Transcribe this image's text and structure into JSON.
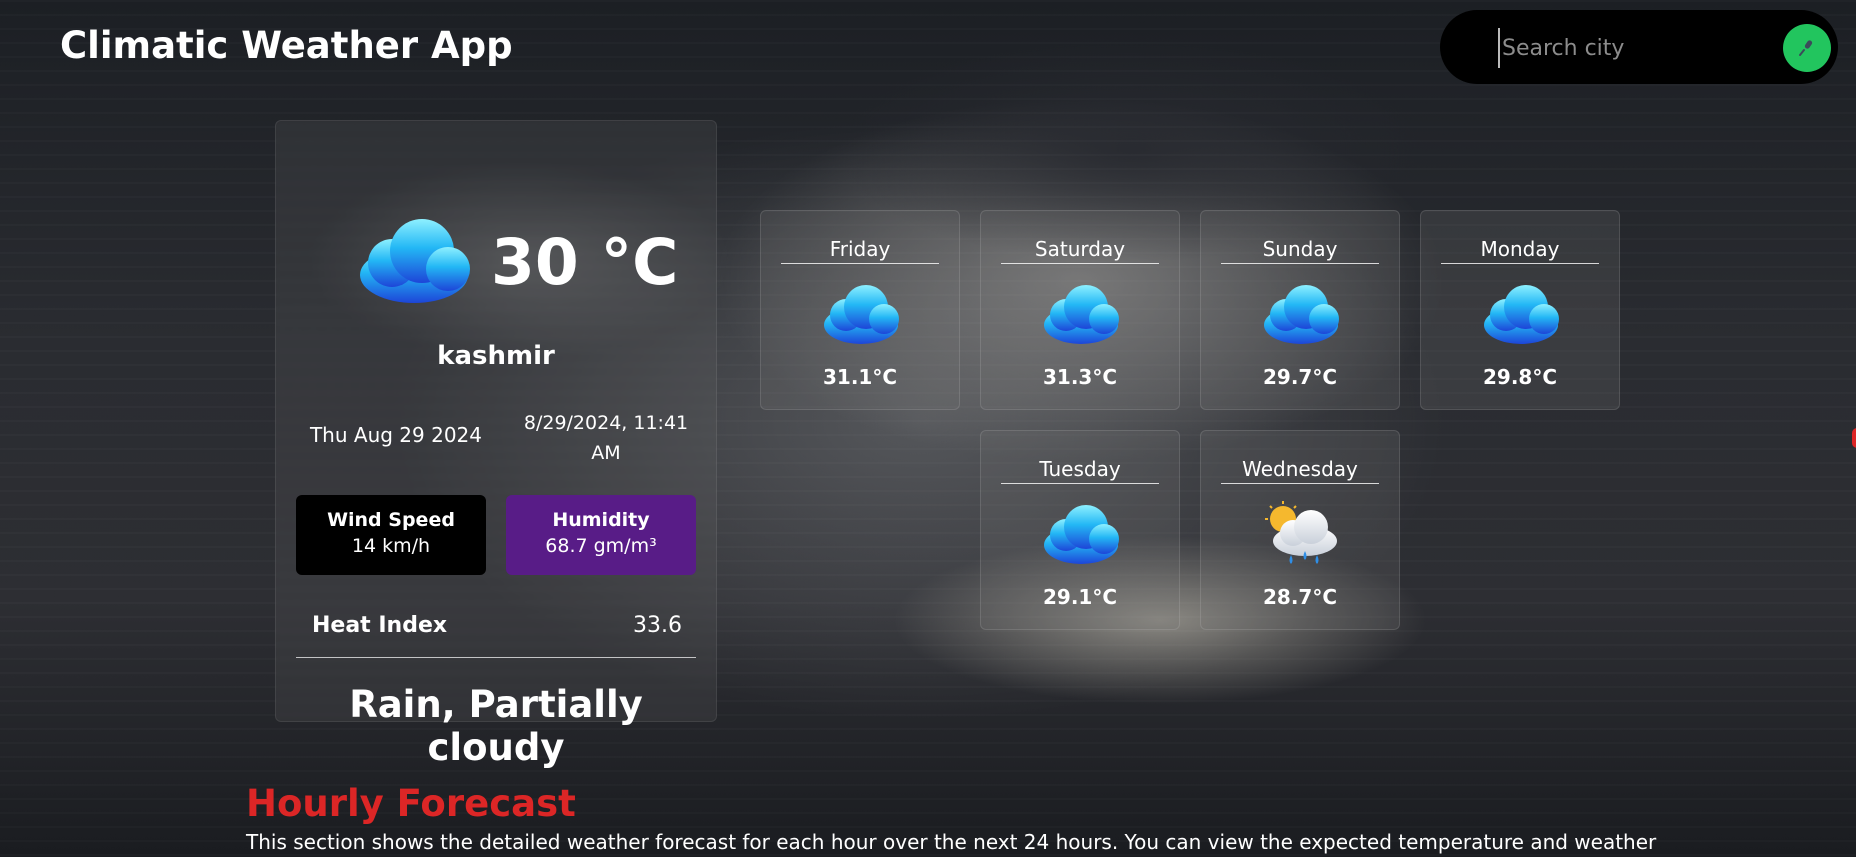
{
  "app": {
    "title": "Climatic Weather App"
  },
  "search": {
    "placeholder": "Search city",
    "mic_icon": "microphone-icon"
  },
  "current": {
    "icon": "cloud-icon",
    "temperature": "30 °C",
    "city": "kashmir",
    "date": "Thu Aug 29 2024",
    "datetime": "8/29/2024, 11:41 AM",
    "wind": {
      "label": "Wind Speed",
      "value": "14 km/h"
    },
    "humidity": {
      "label": "Humidity",
      "value": "68.7 gm/m³"
    },
    "heat_index": {
      "label": "Heat Index",
      "value": "33.6"
    },
    "conditions": "Rain, Partially cloudy"
  },
  "forecast": [
    {
      "day": "Friday",
      "temp": "31.1°C",
      "icon": "cloud-icon"
    },
    {
      "day": "Saturday",
      "temp": "31.3°C",
      "icon": "cloud-icon"
    },
    {
      "day": "Sunday",
      "temp": "29.7°C",
      "icon": "cloud-icon"
    },
    {
      "day": "Monday",
      "temp": "29.8°C",
      "icon": "cloud-icon"
    },
    {
      "day": "Tuesday",
      "temp": "29.1°C",
      "icon": "cloud-icon"
    },
    {
      "day": "Wednesday",
      "temp": "28.7°C",
      "icon": "sun-cloud-rain-icon"
    }
  ],
  "hourly": {
    "title": "Hourly Forecast",
    "description": "This section shows the detailed weather forecast for each hour over the next 24 hours. You can view the expected temperature and weather"
  },
  "colors": {
    "accent": "#22c55e",
    "humidity_bg": "#581c87",
    "hourly_title": "#dc2626"
  }
}
